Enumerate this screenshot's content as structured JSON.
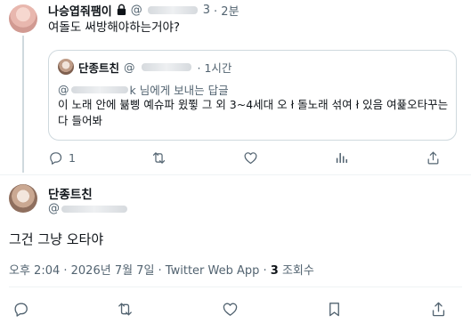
{
  "reply_tweet": {
    "display_name": "나승엽줘팸이",
    "handle": "@",
    "handle_suffix": "3",
    "time": "· 2분",
    "text": "여돌도 써방해야하는거야?"
  },
  "quote": {
    "display_name": "단종트친",
    "handle": "@",
    "time": "· 1시간",
    "reply_prefix": "@",
    "reply_suffix": "k 님에게 보내는 답글",
    "text": "이 노래 안에 뷺삥 예슈파 윘쮷 그 외 3~4세대 오 ł 돌노래 섞여 ł 있음 여퓵오타꾸는 다 들어봐"
  },
  "reply_actions": {
    "reply_count": "1"
  },
  "main_tweet": {
    "display_name": "단종트친",
    "handle": "@",
    "text": "그건 그냥 오타야",
    "meta_prefix": "오후 2:04 · 2026년 7월 7일 · Twitter Web App · ",
    "view_count": "3",
    "view_label": " 조회수"
  },
  "colors": {
    "text": "#0f1419",
    "muted": "#536471",
    "border": "#cfd9de"
  },
  "icons": {
    "reply": "reply-icon",
    "retweet": "retweet-icon",
    "like": "heart-icon",
    "views": "views-bar-icon",
    "bookmark": "bookmark-icon",
    "share": "share-icon",
    "lock": "lock-icon"
  }
}
